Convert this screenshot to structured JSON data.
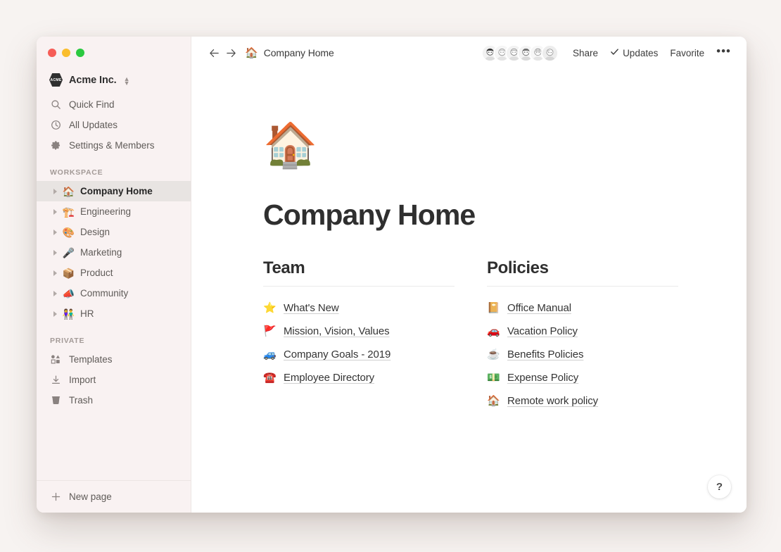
{
  "window": {
    "traffic_lights": [
      {
        "name": "close",
        "color": "#f65d57"
      },
      {
        "name": "minimize",
        "color": "#fabd2d"
      },
      {
        "name": "maximize",
        "color": "#2bc940"
      }
    ]
  },
  "sidebar": {
    "workspace": {
      "name": "Acme Inc.",
      "logo_text": "ACME"
    },
    "nav": [
      {
        "label": "Quick Find",
        "icon": "search-icon"
      },
      {
        "label": "All Updates",
        "icon": "clock-icon"
      },
      {
        "label": "Settings & Members",
        "icon": "gear-icon"
      }
    ],
    "workspace_section": {
      "label": "WORKSPACE",
      "pages": [
        {
          "label": "Company Home",
          "emoji": "🏠",
          "active": true
        },
        {
          "label": "Engineering",
          "emoji": "🏗️",
          "active": false
        },
        {
          "label": "Design",
          "emoji": "🎨",
          "active": false
        },
        {
          "label": "Marketing",
          "emoji": "🎤",
          "active": false
        },
        {
          "label": "Product",
          "emoji": "📦",
          "active": false
        },
        {
          "label": "Community",
          "emoji": "📣",
          "active": false
        },
        {
          "label": "HR",
          "emoji": "👫",
          "active": false
        }
      ]
    },
    "private_section": {
      "label": "PRIVATE",
      "items": [
        {
          "label": "Templates",
          "icon": "templates-icon"
        },
        {
          "label": "Import",
          "icon": "import-icon"
        },
        {
          "label": "Trash",
          "icon": "trash-icon"
        }
      ]
    },
    "new_page": {
      "label": "New page",
      "icon": "plus-icon"
    }
  },
  "topbar": {
    "back_icon": "arrow-left-icon",
    "forward_icon": "arrow-right-icon",
    "breadcrumb": {
      "emoji": "🏠",
      "label": "Company Home"
    },
    "avatar_count": 6,
    "share_label": "Share",
    "updates_label": "Updates",
    "updates_check": "✓",
    "favorite_label": "Favorite",
    "more_label": "•••"
  },
  "page": {
    "cover_emoji": "🏠",
    "title": "Company Home",
    "columns": [
      {
        "heading": "Team",
        "links": [
          {
            "emoji": "⭐",
            "label": "What's New"
          },
          {
            "emoji": "🚩",
            "label": "Mission, Vision, Values"
          },
          {
            "emoji": "🚙",
            "label": "Company Goals - 2019"
          },
          {
            "emoji": "☎️",
            "label": "Employee Directory"
          }
        ]
      },
      {
        "heading": "Policies",
        "links": [
          {
            "emoji": "📔",
            "label": "Office Manual"
          },
          {
            "emoji": "🚗",
            "label": "Vacation Policy"
          },
          {
            "emoji": "☕",
            "label": "Benefits Policies"
          },
          {
            "emoji": "💵",
            "label": "Expense Policy"
          },
          {
            "emoji": "🏠",
            "label": "Remote work policy"
          }
        ]
      }
    ]
  },
  "help": {
    "label": "?"
  },
  "colors": {
    "page_background": "#f7f3f1",
    "sidebar_background": "#f9f2f2",
    "main_background": "#ffffff",
    "active_row": "#e8e4e2",
    "text_primary": "#2f2f2f",
    "text_secondary": "#5f5b58",
    "section_label": "#a39a97",
    "rule": "#ebebeb"
  }
}
